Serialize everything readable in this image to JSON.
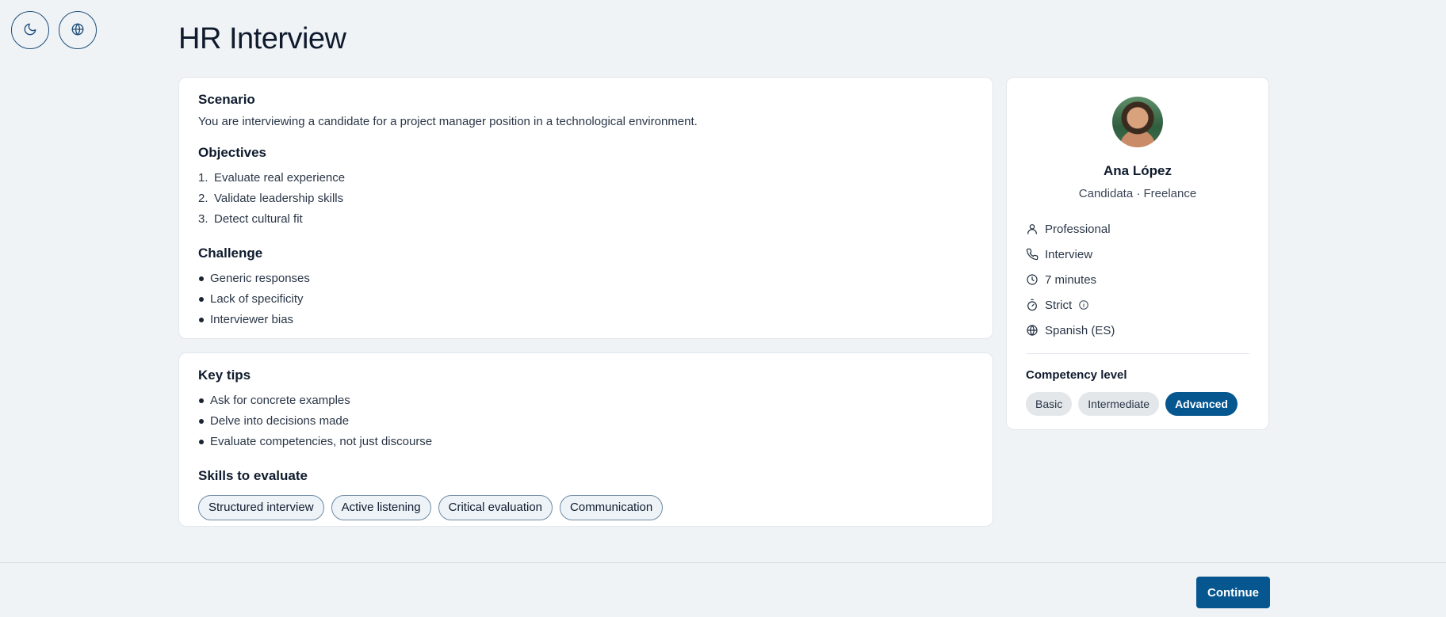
{
  "page": {
    "title": "HR Interview"
  },
  "scenario": {
    "title": "Scenario",
    "text": "You are interviewing a candidate for a project manager position in a technological environment."
  },
  "objectives": {
    "title": "Objectives",
    "items": [
      {
        "num": "1.",
        "label": "Evaluate real experience"
      },
      {
        "num": "2.",
        "label": "Validate leadership skills"
      },
      {
        "num": "3.",
        "label": "Detect cultural fit"
      }
    ]
  },
  "challenge": {
    "title": "Challenge",
    "items": [
      "Generic responses",
      "Lack of specificity",
      "Interviewer bias"
    ]
  },
  "tips": {
    "title": "Key tips",
    "items": [
      "Ask for concrete examples",
      "Delve into decisions made",
      "Evaluate competencies, not just discourse"
    ]
  },
  "skills": {
    "title": "Skills to evaluate",
    "items": [
      "Structured interview",
      "Active listening",
      "Critical evaluation",
      "Communication"
    ]
  },
  "profile": {
    "name": "Ana López",
    "subtitle": "Candidata · Freelance",
    "details": [
      {
        "icon": "user-icon",
        "label": "Professional"
      },
      {
        "icon": "phone-icon",
        "label": "Interview"
      },
      {
        "icon": "clock-icon",
        "label": "7 minutes"
      },
      {
        "icon": "timer-icon",
        "label": "Strict"
      },
      {
        "icon": "globe-icon",
        "label": "Spanish (ES)"
      }
    ],
    "competency_title": "Competency level",
    "levels": [
      "Basic",
      "Intermediate",
      "Advanced"
    ],
    "selected_level": "Advanced"
  },
  "footer": {
    "continue_label": "Continue"
  },
  "colors": {
    "accent": "#065690",
    "background": "#eff3f6"
  }
}
